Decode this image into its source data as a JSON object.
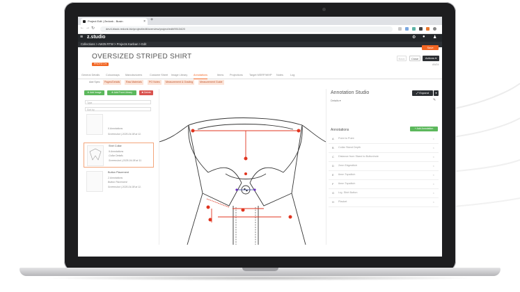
{
  "browser": {
    "tab_title": "Project Edit | Zedonk - Busin",
    "url": "dev4-black.redonk.biz/project/edit/overview/project/edit/9513420"
  },
  "app": {
    "logo": "z.studio",
    "breadcrumb": "Collections > AW25 RTW > Projects Kanban > Edit",
    "save_label": "Save"
  },
  "project": {
    "title": "OVERSIZED STRIPED SHIRT",
    "status_badge": "PROTO 1 ▾",
    "back_label": "Back",
    "close_label": "Close",
    "actions_label": "Actions ▾",
    "code": "AW24"
  },
  "tabs": [
    "General Details",
    "Colourways",
    "Manufacturers",
    "Costume Sheet",
    "Image Library",
    "Annotations",
    "Items",
    "Projections",
    "Target MSRP/WHP",
    "Notes",
    "Log"
  ],
  "subtabs": [
    "Add Spec",
    "Pages/Details",
    "Raw Materials",
    "PO Notes",
    "Measurement & Grading",
    "Measurement Guide"
  ],
  "left_panel": {
    "btn_add_image": "Add Image",
    "btn_add_library": "Add From Library",
    "btn_delete": "Delete",
    "select_type": "Type",
    "select_sort": "Sort by",
    "items": [
      {
        "name": "",
        "count": "0 Annotations",
        "sub": "",
        "date": "Screenshot | 2025-04-08 at 11."
      },
      {
        "name": "Shirt Collar",
        "count": "9 Annotations",
        "sub": "Collar Details",
        "date": "Screenshot | 2025-04-08 at 11."
      },
      {
        "name": "Button Placement",
        "count": "2 Annotations",
        "sub": "Button Placement",
        "date": "Screenshot | 2025-04-08 at 11."
      }
    ]
  },
  "right_panel": {
    "title": "Annotation Studio",
    "expand_label": "Expand",
    "details_label": "Details ▾",
    "annotations_heading": "Annotations",
    "add_label": "+ Add Annotation",
    "annotations": [
      {
        "letter": "A",
        "label": "Point to Point"
      },
      {
        "letter": "B",
        "label": "Collar Stand Depth"
      },
      {
        "letter": "C",
        "label": "Distance from Stand to Buttonhole"
      },
      {
        "letter": "D",
        "label": "2mm Edgestitch"
      },
      {
        "letter": "E",
        "label": "6mm Topstitch"
      },
      {
        "letter": "F",
        "label": "6mm Topstitch"
      },
      {
        "letter": "G",
        "label": "Lrg. Shirt Button"
      },
      {
        "letter": "H",
        "label": "Placket"
      }
    ]
  },
  "colors": {
    "accent": "#f26522",
    "green": "#5cb85c",
    "red": "#d9534f",
    "header": "#232629",
    "annotation": "#e0341f"
  },
  "icons": {
    "menu": "hamburger-icon",
    "settings": "gear-icon",
    "user": "user-icon",
    "close": "close-icon"
  }
}
